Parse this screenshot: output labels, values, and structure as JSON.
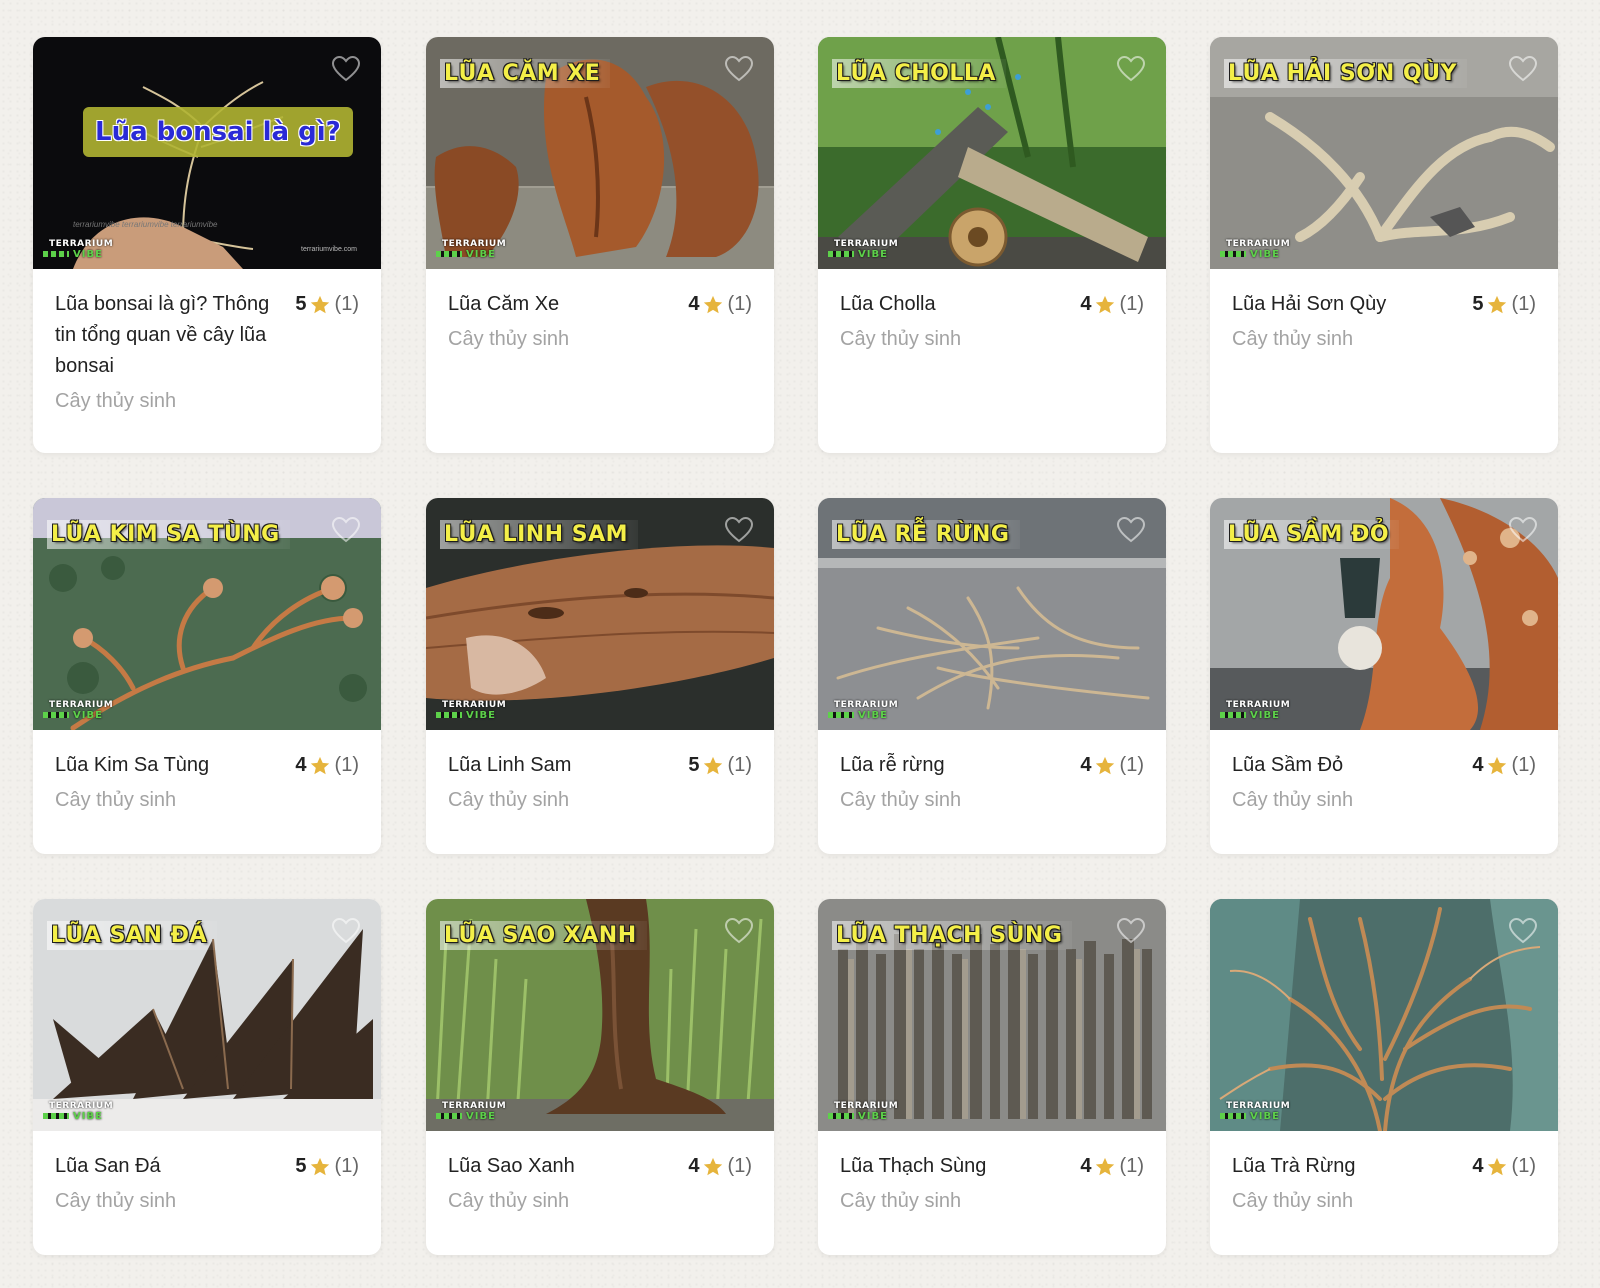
{
  "brand": {
    "line1": "TERRARIUM",
    "line2": "VIBE",
    "site": "terrariumvibe.com"
  },
  "colors": {
    "background": "#f2f0ec",
    "star": "#e6b43c",
    "title_overlay": "#f4ef48"
  },
  "products": [
    {
      "name": "Lũa bonsai là gì? Thông tin tổng quan về cây lũa bonsai",
      "overlay": "Lũa bonsai là gì?",
      "score": "5",
      "count": "(1)",
      "category": "Cây thủy sinh",
      "icon": "heart-outline-icon"
    },
    {
      "name": "Lũa Căm Xe",
      "overlay": "LŨA CĂM XE",
      "score": "4",
      "count": "(1)",
      "category": "Cây thủy sinh",
      "icon": "heart-outline-icon"
    },
    {
      "name": "Lũa Cholla",
      "overlay": "LŨA CHOLLA",
      "score": "4",
      "count": "(1)",
      "category": "Cây thủy sinh",
      "icon": "heart-outline-icon"
    },
    {
      "name": "Lũa Hải Sơn Qùy",
      "overlay": "LŨA HẢI SƠN QÙY",
      "score": "5",
      "count": "(1)",
      "category": "Cây thủy sinh",
      "icon": "heart-outline-icon"
    },
    {
      "name": "Lũa Kim Sa Tùng",
      "overlay": "LŨA KIM SA TÙNG",
      "score": "4",
      "count": "(1)",
      "category": "Cây thủy sinh",
      "icon": "heart-outline-icon"
    },
    {
      "name": "Lũa Linh Sam",
      "overlay": "LŨA LINH SAM",
      "score": "5",
      "count": "(1)",
      "category": "Cây thủy sinh",
      "icon": "heart-outline-icon"
    },
    {
      "name": "Lũa rễ rừng",
      "overlay": "LŨA RỄ RỪNG",
      "score": "4",
      "count": "(1)",
      "category": "Cây thủy sinh",
      "icon": "heart-outline-icon"
    },
    {
      "name": "Lũa Sầm Đỏ",
      "overlay": "LŨA SẦM ĐỎ",
      "score": "4",
      "count": "(1)",
      "category": "Cây thủy sinh",
      "icon": "heart-outline-icon"
    },
    {
      "name": "Lũa San Đá",
      "overlay": "LŨA SAN ĐÁ",
      "score": "5",
      "count": "(1)",
      "category": "Cây thủy sinh",
      "icon": "heart-outline-icon"
    },
    {
      "name": "Lũa Sao Xanh",
      "overlay": "LŨA SAO XANH",
      "score": "4",
      "count": "(1)",
      "category": "Cây thủy sinh",
      "icon": "heart-outline-icon"
    },
    {
      "name": "Lũa Thạch Sùng",
      "overlay": "LŨA THẠCH SÙNG",
      "score": "4",
      "count": "(1)",
      "category": "Cây thủy sinh",
      "icon": "heart-outline-icon"
    },
    {
      "name": "Lũa Trà Rừng",
      "overlay": "",
      "score": "4",
      "count": "(1)",
      "category": "Cây thủy sinh",
      "icon": "heart-outline-icon"
    }
  ]
}
